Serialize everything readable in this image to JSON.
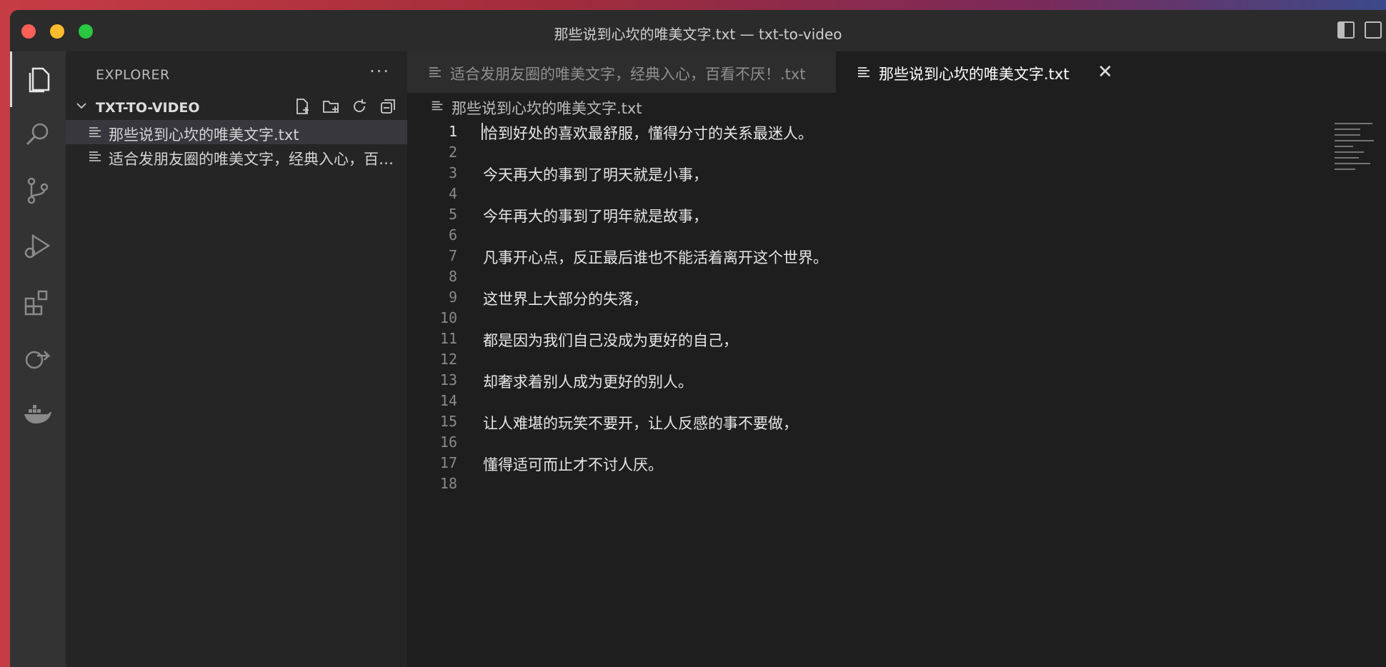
{
  "window": {
    "title": "那些说到心坎的唯美文字.txt — txt-to-video"
  },
  "activity_bar": {
    "items": [
      {
        "name": "explorer",
        "icon": "files-icon",
        "active": true
      },
      {
        "name": "search",
        "icon": "search-icon",
        "active": false
      },
      {
        "name": "source-control",
        "icon": "source-control-icon",
        "active": false
      },
      {
        "name": "run-and-debug",
        "icon": "run-debug-icon",
        "active": false
      },
      {
        "name": "extensions",
        "icon": "extensions-icon",
        "active": false
      },
      {
        "name": "remote-explorer",
        "icon": "remote-icon",
        "active": false
      },
      {
        "name": "docker",
        "icon": "docker-icon",
        "active": false
      }
    ]
  },
  "sidebar": {
    "header": "EXPLORER",
    "more": "···",
    "folder": {
      "name": "TXT-TO-VIDEO",
      "actions": [
        "new-file-icon",
        "new-folder-icon",
        "refresh-icon",
        "collapse-all-icon"
      ]
    },
    "files": [
      {
        "label": "那些说到心坎的唯美文字.txt",
        "selected": true
      },
      {
        "label": "适合发朋友圈的唯美文字，经典入心，百看不厌！.txt",
        "selected": false
      }
    ]
  },
  "tabs": [
    {
      "label": "适合发朋友圈的唯美文字，经典入心，百看不厌！.txt",
      "active": false
    },
    {
      "label": "那些说到心坎的唯美文字.txt",
      "active": true,
      "close": "✕"
    }
  ],
  "breadcrumb": {
    "label": "那些说到心坎的唯美文字.txt"
  },
  "editor": {
    "current_line": "1",
    "lines": [
      {
        "n": "1",
        "text": "恰到好处的喜欢最舒服，懂得分寸的关系最迷人。"
      },
      {
        "n": "2",
        "text": ""
      },
      {
        "n": "3",
        "text": "今天再大的事到了明天就是小事，"
      },
      {
        "n": "4",
        "text": ""
      },
      {
        "n": "5",
        "text": "今年再大的事到了明年就是故事，"
      },
      {
        "n": "6",
        "text": ""
      },
      {
        "n": "7",
        "text": "凡事开心点，反正最后谁也不能活着离开这个世界。"
      },
      {
        "n": "8",
        "text": ""
      },
      {
        "n": "9",
        "text": "这世界上大部分的失落，"
      },
      {
        "n": "10",
        "text": ""
      },
      {
        "n": "11",
        "text": "都是因为我们自己没成为更好的自己，"
      },
      {
        "n": "12",
        "text": ""
      },
      {
        "n": "13",
        "text": "却奢求着别人成为更好的别人。"
      },
      {
        "n": "14",
        "text": ""
      },
      {
        "n": "15",
        "text": "让人难堪的玩笑不要开，让人反感的事不要做，"
      },
      {
        "n": "16",
        "text": ""
      },
      {
        "n": "17",
        "text": "懂得适可而止才不讨人厌。"
      },
      {
        "n": "18",
        "text": ""
      }
    ]
  },
  "colors": {
    "editor_bg": "#1e1e1e",
    "sidebar_bg": "#252526",
    "activity_bg": "#333333",
    "selection_bg": "#37373d"
  }
}
